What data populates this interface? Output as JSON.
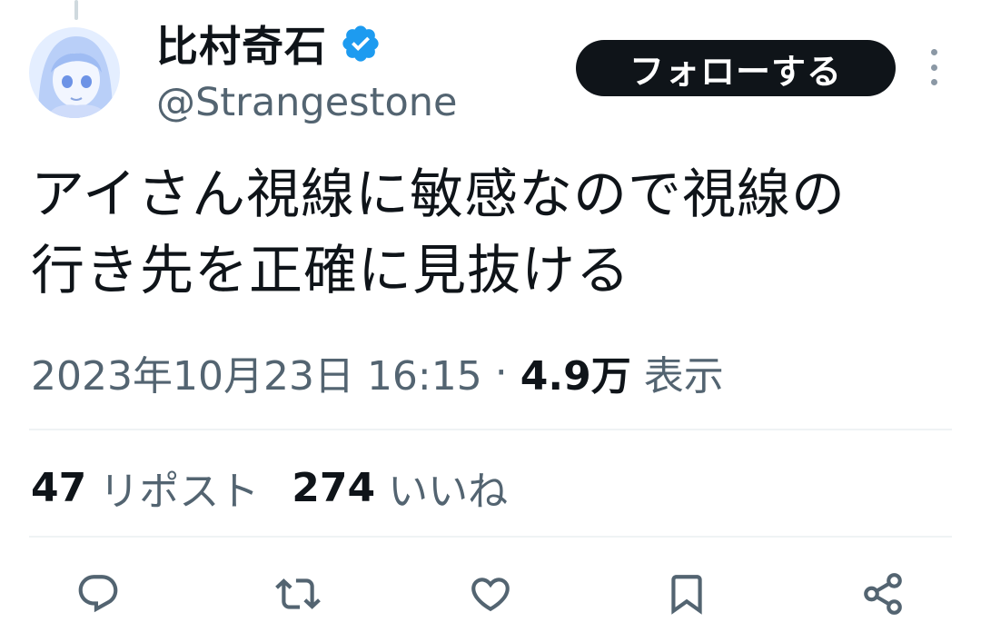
{
  "tweet": {
    "author": {
      "display_name": "比村奇石",
      "handle": "@Strangestone",
      "verified": true
    },
    "follow_label": "フォローする",
    "text_lines": [
      "アイさん視線に敏感なので視線の",
      "行き先を正確に見抜ける"
    ],
    "meta": {
      "timestamp": "2023年10月23日 16:15",
      "separator": "·",
      "views_count": "4.9万",
      "views_label": "表示"
    },
    "stats": {
      "reposts_count": "47",
      "reposts_label": "リポスト",
      "likes_count": "274",
      "likes_label": "いいね"
    },
    "actions": [
      "reply-icon",
      "repost-icon",
      "like-icon",
      "bookmark-icon",
      "share-icon"
    ]
  },
  "colors": {
    "text_primary": "#0f1419",
    "text_secondary": "#536471",
    "verified_blue": "#1d9bf0",
    "divider": "#eff3f4",
    "button_bg": "#0f1419"
  }
}
